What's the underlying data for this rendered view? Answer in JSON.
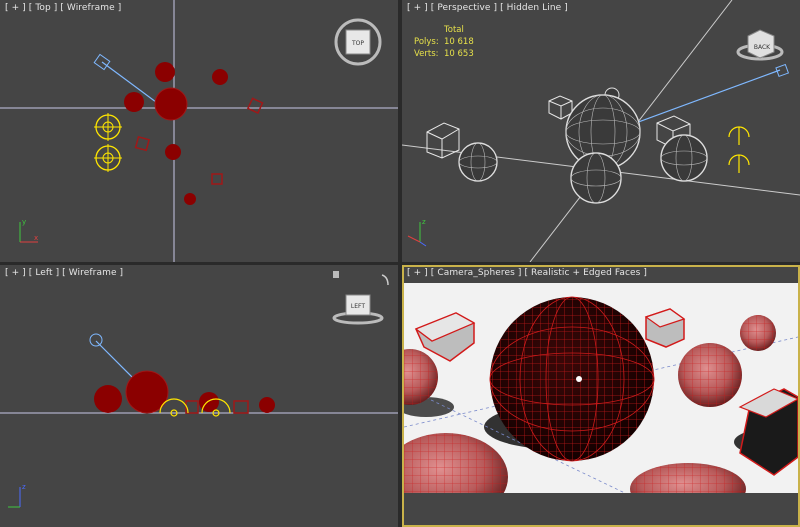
{
  "viewports": {
    "top": {
      "label": "[ + ] [ Top ] [ Wireframe ]",
      "cube_label": "TOP"
    },
    "perspective": {
      "label": "[ + ] [ Perspective ] [ Hidden Line ]",
      "cube_label": "BACK"
    },
    "left": {
      "label": "[ + ] [ Left ] [ Wireframe ]",
      "cube_label": "LEFT"
    },
    "camera": {
      "label": "[ + ] [ Camera_Spheres ] [ Realistic + Edged Faces ]"
    }
  },
  "stats": {
    "title": "Total",
    "polys_label": "Polys:",
    "polys_value": "10 618",
    "verts_label": "Verts:",
    "verts_value": "10 653"
  },
  "axis": {
    "x": "x",
    "y": "y",
    "z": "z"
  },
  "colors": {
    "active_border": "#c9b24a",
    "viewport_bg": "#454545",
    "object_red": "#8b0000",
    "helper_yellow": "#ffe600",
    "camera_blue": "#7fb8ff",
    "stats_yellow": "#e6e04a"
  }
}
